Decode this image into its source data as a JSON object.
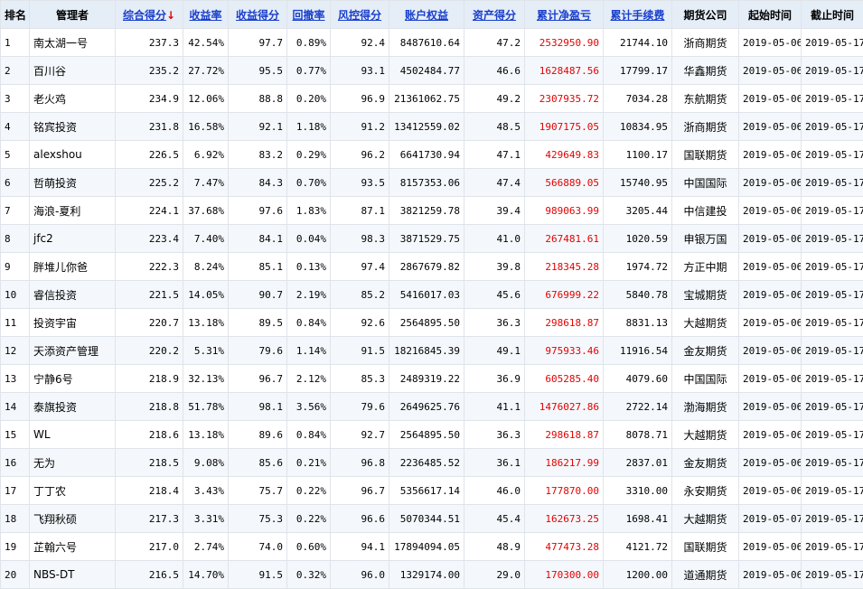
{
  "headers": {
    "rank": "排名",
    "manager": "管理者",
    "composite": "综合得分",
    "composite_arrow": "↓",
    "return_rate": "收益率",
    "return_score": "收益得分",
    "drawdown": "回撤率",
    "risk_score": "风控得分",
    "equity": "账户权益",
    "asset_score": "资产得分",
    "net_profit": "累计净盈亏",
    "fees": "累计手续费",
    "broker": "期货公司",
    "start": "起始时间",
    "end": "截止时间"
  },
  "colors": {
    "header_bg": "#e5edf7",
    "link": "#1a3fcc",
    "profit": "#e60000"
  },
  "rows": [
    {
      "rank": "1",
      "manager": "南太湖一号",
      "composite": "237.3",
      "return_rate": "42.54%",
      "return_score": "97.7",
      "drawdown": "0.89%",
      "risk_score": "92.4",
      "equity": "8487610.64",
      "asset_score": "47.2",
      "net_profit": "2532950.90",
      "fees": "21744.10",
      "broker": "浙商期货",
      "start": "2019-05-06",
      "end": "2019-05-17"
    },
    {
      "rank": "2",
      "manager": "百川谷",
      "composite": "235.2",
      "return_rate": "27.72%",
      "return_score": "95.5",
      "drawdown": "0.77%",
      "risk_score": "93.1",
      "equity": "4502484.77",
      "asset_score": "46.6",
      "net_profit": "1628487.56",
      "fees": "17799.17",
      "broker": "华鑫期货",
      "start": "2019-05-06",
      "end": "2019-05-17"
    },
    {
      "rank": "3",
      "manager": "老火鸡",
      "composite": "234.9",
      "return_rate": "12.06%",
      "return_score": "88.8",
      "drawdown": "0.20%",
      "risk_score": "96.9",
      "equity": "21361062.75",
      "asset_score": "49.2",
      "net_profit": "2307935.72",
      "fees": "7034.28",
      "broker": "东航期货",
      "start": "2019-05-06",
      "end": "2019-05-17"
    },
    {
      "rank": "4",
      "manager": "铭宾投资",
      "composite": "231.8",
      "return_rate": "16.58%",
      "return_score": "92.1",
      "drawdown": "1.18%",
      "risk_score": "91.2",
      "equity": "13412559.02",
      "asset_score": "48.5",
      "net_profit": "1907175.05",
      "fees": "10834.95",
      "broker": "浙商期货",
      "start": "2019-05-06",
      "end": "2019-05-17"
    },
    {
      "rank": "5",
      "manager": "alexshou",
      "composite": "226.5",
      "return_rate": "6.92%",
      "return_score": "83.2",
      "drawdown": "0.29%",
      "risk_score": "96.2",
      "equity": "6641730.94",
      "asset_score": "47.1",
      "net_profit": "429649.83",
      "fees": "1100.17",
      "broker": "国联期货",
      "start": "2019-05-06",
      "end": "2019-05-17"
    },
    {
      "rank": "6",
      "manager": "哲萌投资",
      "composite": "225.2",
      "return_rate": "7.47%",
      "return_score": "84.3",
      "drawdown": "0.70%",
      "risk_score": "93.5",
      "equity": "8157353.06",
      "asset_score": "47.4",
      "net_profit": "566889.05",
      "fees": "15740.95",
      "broker": "中国国际",
      "start": "2019-05-06",
      "end": "2019-05-17"
    },
    {
      "rank": "7",
      "manager": "海浪-夏利",
      "composite": "224.1",
      "return_rate": "37.68%",
      "return_score": "97.6",
      "drawdown": "1.83%",
      "risk_score": "87.1",
      "equity": "3821259.78",
      "asset_score": "39.4",
      "net_profit": "989063.99",
      "fees": "3205.44",
      "broker": "中信建投",
      "start": "2019-05-06",
      "end": "2019-05-17"
    },
    {
      "rank": "8",
      "manager": "jfc2",
      "composite": "223.4",
      "return_rate": "7.40%",
      "return_score": "84.1",
      "drawdown": "0.04%",
      "risk_score": "98.3",
      "equity": "3871529.75",
      "asset_score": "41.0",
      "net_profit": "267481.61",
      "fees": "1020.59",
      "broker": "申银万国",
      "start": "2019-05-06",
      "end": "2019-05-17"
    },
    {
      "rank": "9",
      "manager": "胖堆儿你爸",
      "composite": "222.3",
      "return_rate": "8.24%",
      "return_score": "85.1",
      "drawdown": "0.13%",
      "risk_score": "97.4",
      "equity": "2867679.82",
      "asset_score": "39.8",
      "net_profit": "218345.28",
      "fees": "1974.72",
      "broker": "方正中期",
      "start": "2019-05-06",
      "end": "2019-05-17"
    },
    {
      "rank": "10",
      "manager": "睿信投资",
      "composite": "221.5",
      "return_rate": "14.05%",
      "return_score": "90.7",
      "drawdown": "2.19%",
      "risk_score": "85.2",
      "equity": "5416017.03",
      "asset_score": "45.6",
      "net_profit": "676999.22",
      "fees": "5840.78",
      "broker": "宝城期货",
      "start": "2019-05-06",
      "end": "2019-05-17"
    },
    {
      "rank": "11",
      "manager": "投资宇宙",
      "composite": "220.7",
      "return_rate": "13.18%",
      "return_score": "89.5",
      "drawdown": "0.84%",
      "risk_score": "92.6",
      "equity": "2564895.50",
      "asset_score": "36.3",
      "net_profit": "298618.87",
      "fees": "8831.13",
      "broker": "大越期货",
      "start": "2019-05-06",
      "end": "2019-05-17"
    },
    {
      "rank": "12",
      "manager": "天添资产管理",
      "composite": "220.2",
      "return_rate": "5.31%",
      "return_score": "79.6",
      "drawdown": "1.14%",
      "risk_score": "91.5",
      "equity": "18216845.39",
      "asset_score": "49.1",
      "net_profit": "975933.46",
      "fees": "11916.54",
      "broker": "金友期货",
      "start": "2019-05-06",
      "end": "2019-05-17"
    },
    {
      "rank": "13",
      "manager": "宁静6号",
      "composite": "218.9",
      "return_rate": "32.13%",
      "return_score": "96.7",
      "drawdown": "2.12%",
      "risk_score": "85.3",
      "equity": "2489319.22",
      "asset_score": "36.9",
      "net_profit": "605285.40",
      "fees": "4079.60",
      "broker": "中国国际",
      "start": "2019-05-06",
      "end": "2019-05-17"
    },
    {
      "rank": "14",
      "manager": "泰旗投资",
      "composite": "218.8",
      "return_rate": "51.78%",
      "return_score": "98.1",
      "drawdown": "3.56%",
      "risk_score": "79.6",
      "equity": "2649625.76",
      "asset_score": "41.1",
      "net_profit": "1476027.86",
      "fees": "2722.14",
      "broker": "渤海期货",
      "start": "2019-05-06",
      "end": "2019-05-17"
    },
    {
      "rank": "15",
      "manager": "WL",
      "composite": "218.6",
      "return_rate": "13.18%",
      "return_score": "89.6",
      "drawdown": "0.84%",
      "risk_score": "92.7",
      "equity": "2564895.50",
      "asset_score": "36.3",
      "net_profit": "298618.87",
      "fees": "8078.71",
      "broker": "大越期货",
      "start": "2019-05-06",
      "end": "2019-05-17"
    },
    {
      "rank": "16",
      "manager": "无为",
      "composite": "218.5",
      "return_rate": "9.08%",
      "return_score": "85.6",
      "drawdown": "0.21%",
      "risk_score": "96.8",
      "equity": "2236485.52",
      "asset_score": "36.1",
      "net_profit": "186217.99",
      "fees": "2837.01",
      "broker": "金友期货",
      "start": "2019-05-06",
      "end": "2019-05-17"
    },
    {
      "rank": "17",
      "manager": "丁丁农",
      "composite": "218.4",
      "return_rate": "3.43%",
      "return_score": "75.7",
      "drawdown": "0.22%",
      "risk_score": "96.7",
      "equity": "5356617.14",
      "asset_score": "46.0",
      "net_profit": "177870.00",
      "fees": "3310.00",
      "broker": "永安期货",
      "start": "2019-05-06",
      "end": "2019-05-17"
    },
    {
      "rank": "18",
      "manager": "飞翔秋硕",
      "composite": "217.3",
      "return_rate": "3.31%",
      "return_score": "75.3",
      "drawdown": "0.22%",
      "risk_score": "96.6",
      "equity": "5070344.51",
      "asset_score": "45.4",
      "net_profit": "162673.25",
      "fees": "1698.41",
      "broker": "大越期货",
      "start": "2019-05-07",
      "end": "2019-05-17"
    },
    {
      "rank": "19",
      "manager": "芷翰六号",
      "composite": "217.0",
      "return_rate": "2.74%",
      "return_score": "74.0",
      "drawdown": "0.60%",
      "risk_score": "94.1",
      "equity": "17894094.05",
      "asset_score": "48.9",
      "net_profit": "477473.28",
      "fees": "4121.72",
      "broker": "国联期货",
      "start": "2019-05-06",
      "end": "2019-05-17"
    },
    {
      "rank": "20",
      "manager": "NBS-DT",
      "composite": "216.5",
      "return_rate": "14.70%",
      "return_score": "91.5",
      "drawdown": "0.32%",
      "risk_score": "96.0",
      "equity": "1329174.00",
      "asset_score": "29.0",
      "net_profit": "170300.00",
      "fees": "1200.00",
      "broker": "道通期货",
      "start": "2019-05-06",
      "end": "2019-05-17"
    }
  ]
}
